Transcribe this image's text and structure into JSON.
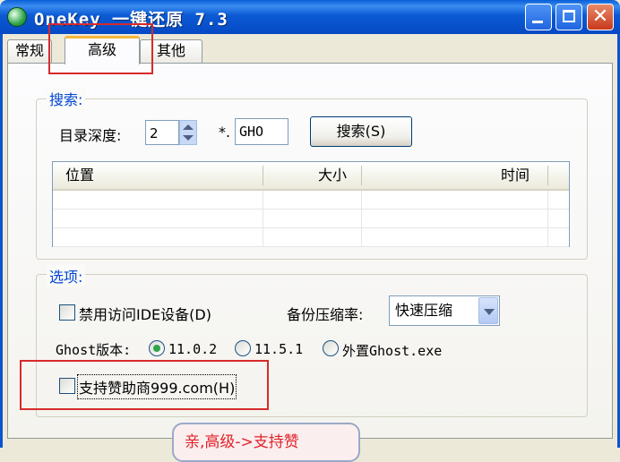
{
  "window": {
    "title": "OneKey 一键还原 7.3",
    "close_glyph": "✕"
  },
  "tabs": [
    {
      "label": "常规",
      "selected": false
    },
    {
      "label": "高级",
      "selected": true
    },
    {
      "label": "其他",
      "selected": false
    }
  ],
  "search": {
    "group_label": "搜索:",
    "depth_label": "目录深度:",
    "depth_value": "2",
    "pattern_prefix": "*.",
    "pattern_value": "GHO",
    "button_label": "搜索(S)",
    "columns": [
      "位置",
      "大小",
      "时间"
    ]
  },
  "options": {
    "group_label": "选项:",
    "disable_ide_label": "禁用访问IDE设备(D)",
    "disable_ide_checked": false,
    "compression_label": "备份压缩率:",
    "compression_value": "快速压缩",
    "ghost_version_label": "Ghost版本:",
    "ghost_versions": [
      {
        "label": "11.0.2",
        "selected": true
      },
      {
        "label": "11.5.1",
        "selected": false
      },
      {
        "label": "外置Ghost.exe",
        "selected": false
      }
    ],
    "sponsor_label": "支持赞助商999.com(H)",
    "sponsor_checked": false
  },
  "annotation": {
    "callout_text": "亲,高级->支持赞"
  },
  "colors": {
    "titlebar": "#0a5fd8",
    "group_label": "#0046d5",
    "highlight_box": "#d62b2b",
    "callout_text": "#e0232b",
    "radio_dot": "#2fa44a"
  }
}
